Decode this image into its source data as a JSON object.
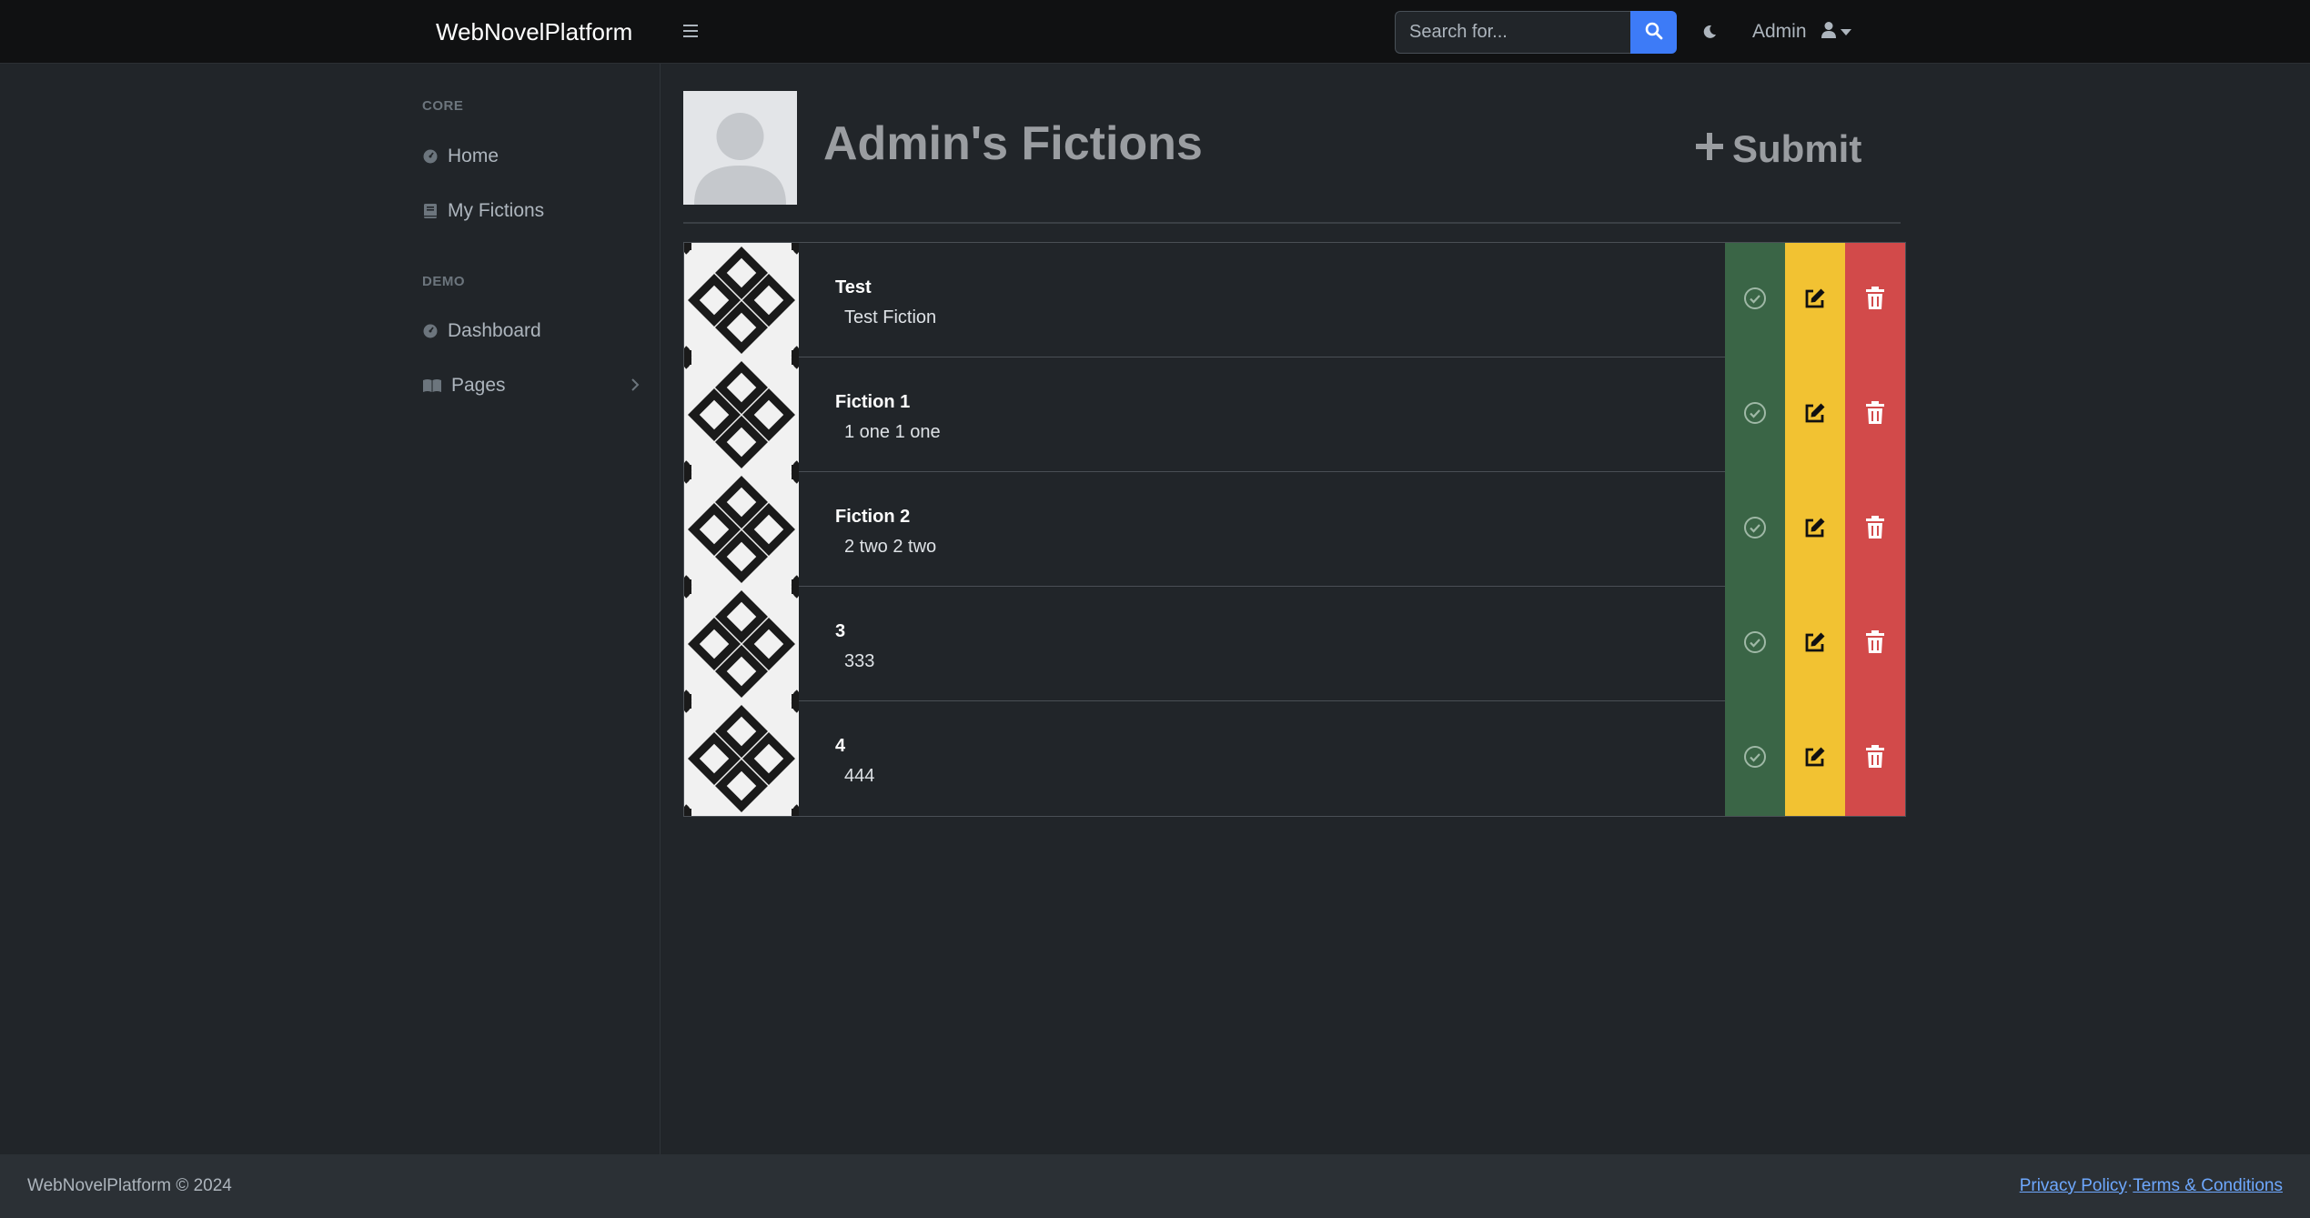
{
  "navbar": {
    "brand": "WebNovelPlatform",
    "search_placeholder": "Search for...",
    "user_name": "Admin"
  },
  "sidebar": {
    "sections": [
      {
        "heading": "CORE",
        "items": [
          {
            "label": "Home",
            "icon": "gauge-icon"
          },
          {
            "label": "My Fictions",
            "icon": "book-icon"
          }
        ]
      },
      {
        "heading": "DEMO",
        "items": [
          {
            "label": "Dashboard",
            "icon": "gauge-icon"
          },
          {
            "label": "Pages",
            "icon": "book-open-icon",
            "has_submenu": true
          }
        ]
      }
    ]
  },
  "main": {
    "title": "Admin's Fictions",
    "submit_label": "Submit",
    "fictions": [
      {
        "title": "Test",
        "description": "Test Fiction"
      },
      {
        "title": "Fiction 1",
        "description": "1 one 1 one"
      },
      {
        "title": "Fiction 2",
        "description": "2 two 2 two"
      },
      {
        "title": "3",
        "description": "333"
      },
      {
        "title": "4",
        "description": "444"
      }
    ]
  },
  "footer": {
    "copyright": "WebNovelPlatform © 2024",
    "privacy": "Privacy Policy",
    "separator": "·",
    "terms": "Terms & Conditions"
  },
  "colors": {
    "navbar_bg": "#101112",
    "body_bg": "#212529",
    "primary": "#3d7bf7",
    "success": "#3a6546",
    "warning": "#f2c232",
    "danger": "#d24a4a"
  }
}
